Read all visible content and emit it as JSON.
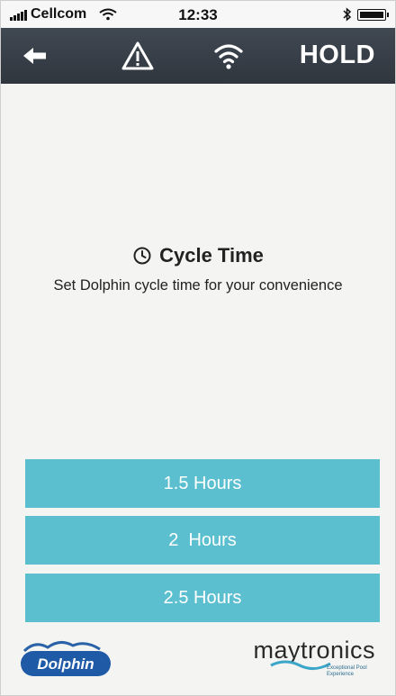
{
  "status_bar": {
    "carrier": "Cellcom",
    "time": "12:33"
  },
  "header": {
    "hold_label": "HOLD",
    "icons": [
      "back-arrow-icon",
      "warning-icon",
      "wifi-icon"
    ]
  },
  "content": {
    "title": "Cycle Time",
    "subtitle": "Set Dolphin cycle time for your convenience"
  },
  "options": [
    {
      "label": "1.5 Hours"
    },
    {
      "label": "2  Hours"
    },
    {
      "label": "2.5 Hours"
    }
  ],
  "footer": {
    "dolphin_logo_text": "Dolphin",
    "maytronics_logo_text": "maytronics",
    "maytronics_tagline": "Exceptional Pool Experience"
  },
  "colors": {
    "header_bg": "#353c44",
    "button_bg": "#5bbfcf",
    "button_text": "#ffffff"
  }
}
